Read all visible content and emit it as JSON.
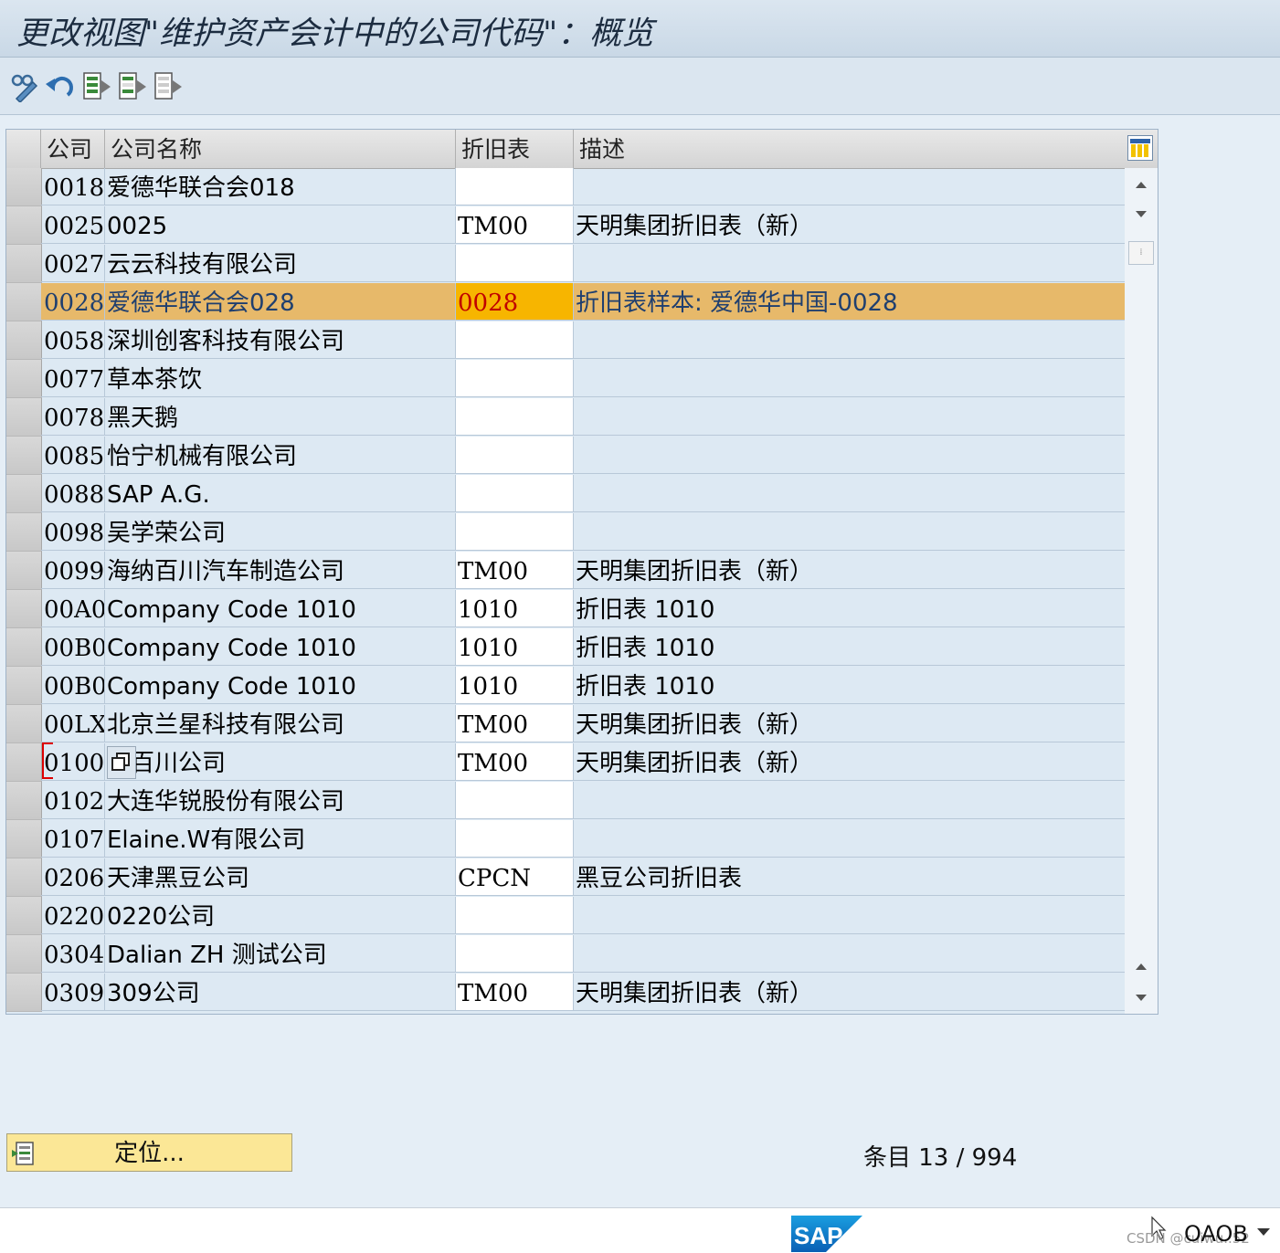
{
  "window": {
    "title": "更改视图\"维护资产会计中的公司代码\"：概览"
  },
  "toolbar": {
    "buttons": [
      "display-change-icon",
      "undo-icon",
      "select-all-icon",
      "select-block-icon",
      "deselect-all-icon"
    ]
  },
  "table": {
    "columns": [
      "公司",
      "公司名称",
      "折旧表",
      "描述"
    ],
    "selected_row_index": 3,
    "rows": [
      {
        "code": "0018",
        "name": "爱德华联合会018",
        "dep": "",
        "desc": ""
      },
      {
        "code": "0025",
        "name": "0025",
        "dep": "TM00",
        "desc": "天明集团折旧表（新）"
      },
      {
        "code": "0027",
        "name": "云云科技有限公司",
        "dep": "",
        "desc": ""
      },
      {
        "code": "0028",
        "name": "爱德华联合会028",
        "dep": "0028",
        "desc": "折旧表样本: 爱德华中国-0028"
      },
      {
        "code": "0058",
        "name": "深圳创客科技有限公司",
        "dep": "",
        "desc": ""
      },
      {
        "code": "0077",
        "name": "草本茶饮",
        "dep": "",
        "desc": ""
      },
      {
        "code": "0078",
        "name": "黑天鹅",
        "dep": "",
        "desc": ""
      },
      {
        "code": "0085",
        "name": "怡宁机械有限公司",
        "dep": "",
        "desc": ""
      },
      {
        "code": "0088",
        "name": "SAP A.G.",
        "dep": "",
        "desc": ""
      },
      {
        "code": "0098",
        "name": "吴学荣公司",
        "dep": "",
        "desc": ""
      },
      {
        "code": "0099",
        "name": "海纳百川汽车制造公司",
        "dep": "TM00",
        "desc": "天明集团折旧表（新）"
      },
      {
        "code": "00A0",
        "name": "Company Code 1010",
        "dep": "1010",
        "desc": "折旧表 1010"
      },
      {
        "code": "00B0",
        "name": "Company Code 1010",
        "dep": "1010",
        "desc": "折旧表 1010"
      },
      {
        "code": "00B0",
        "name": "Company Code 1010",
        "dep": "1010",
        "desc": "折旧表 1010"
      },
      {
        "code": "00LX",
        "name": "北京兰星科技有限公司",
        "dep": "TM00",
        "desc": "天明集团折旧表（新）"
      },
      {
        "code": "0100",
        "name": "纳百川公司",
        "dep": "TM00",
        "desc": "天明集团折旧表（新）"
      },
      {
        "code": "0102",
        "name": "大连华锐股份有限公司",
        "dep": "",
        "desc": ""
      },
      {
        "code": "0107",
        "name": "Elaine.W有限公司",
        "dep": "",
        "desc": ""
      },
      {
        "code": "0206",
        "name": "天津黑豆公司",
        "dep": "CPCN",
        "desc": "黑豆公司折旧表"
      },
      {
        "code": "0220",
        "name": "0220公司",
        "dep": "",
        "desc": ""
      },
      {
        "code": "0304",
        "name": "Dalian ZH 测试公司",
        "dep": "",
        "desc": ""
      },
      {
        "code": "0309",
        "name": "309公司",
        "dep": "TM00",
        "desc": "天明集团折旧表（新）"
      }
    ]
  },
  "footer": {
    "position_button": "定位...",
    "entries_label": "条目 13 / 994"
  },
  "statusbar": {
    "logo": "SAP",
    "tcode": "OAOB",
    "watermark": "CSDN @cuiwu..52"
  }
}
